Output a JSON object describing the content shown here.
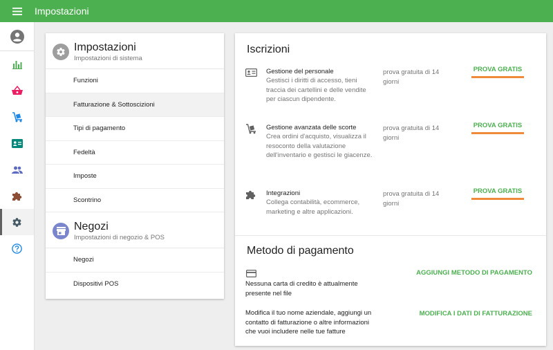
{
  "app": {
    "title": "Impostazioni"
  },
  "left": {
    "sections": [
      {
        "title": "Impostazioni",
        "subtitle": "Impostazioni di sistema",
        "items": [
          "Funzioni",
          "Fatturazione & Sottoscizioni",
          "Tipi di pagamento",
          "Fedeltà",
          "Imposte",
          "Scontrino"
        ]
      },
      {
        "title": "Negozi",
        "subtitle": "Impostazioni di negozio & POS",
        "items": [
          "Negozi",
          "Dispositivi POS"
        ]
      }
    ]
  },
  "subscriptions": {
    "title": "Iscrizioni",
    "items": [
      {
        "name": "Gestione del personale",
        "description": "Gestisci i diritti di accesso, tieni traccia dei cartellini e delle vendite per ciascun dipendente.",
        "trial": "prova gratuita di 14 giorni",
        "action": "PROVA GRATIS",
        "icon": "id-card-icon"
      },
      {
        "name": "Gestione avanzata delle scorte",
        "description": "Crea ordini d'acquisto, visualizza il resoconto della valutazione dell'inventario e gestisci le giacenze.",
        "trial": "prova gratuita di 14 giorni",
        "action": "PROVA GRATIS",
        "icon": "cart-dolly-icon"
      },
      {
        "name": "Integrazioni",
        "description": "Collega contabilità, ecommerce, marketing e altre applicazioni.",
        "trial": "prova gratuita di 14 giorni",
        "action": "PROVA GRATIS",
        "icon": "puzzle-icon"
      }
    ]
  },
  "payment": {
    "title": "Metodo di pagamento",
    "card_text": "Nessuna carta di credito è attualmente presente nel file",
    "add_action": "AGGIUNGI METODO DI PAGAMENTO",
    "billing_text": "Modifica il tuo nome aziendale, aggiungi un contatto di fatturazione o altre informazioni che vuoi includere nelle tue fatture",
    "billing_action": "MODIFICA I DATI DI FATTURAZIONE"
  },
  "colors": {
    "primary": "#4caf50",
    "accent_underline": "#ef8a3a",
    "section_icon": "#7986cb"
  }
}
